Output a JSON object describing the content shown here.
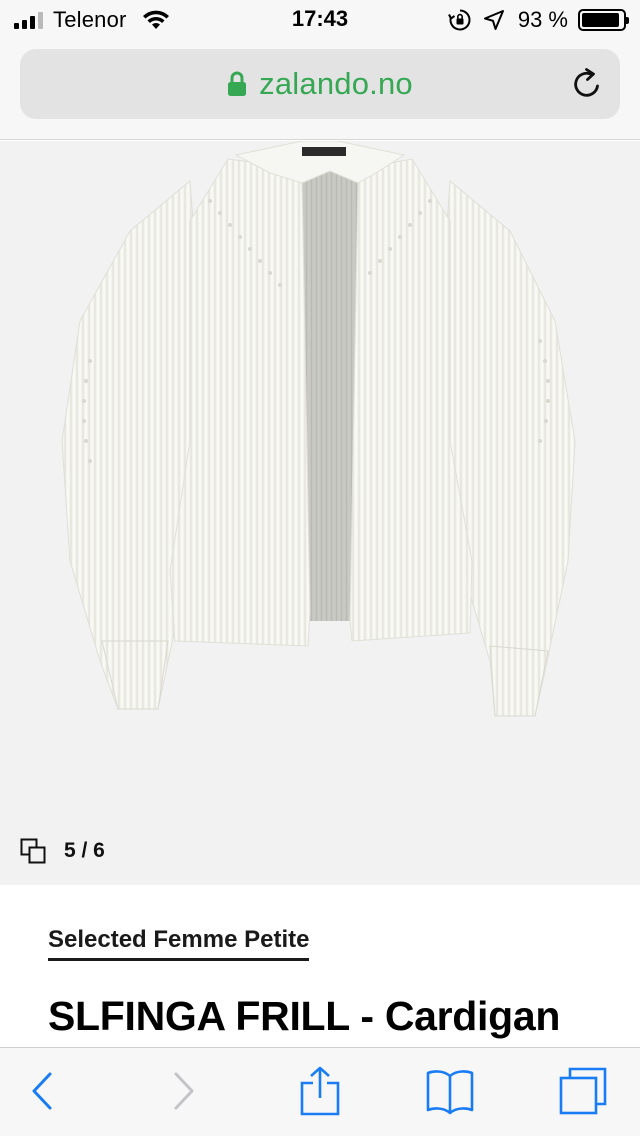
{
  "status_bar": {
    "carrier": "Telenor",
    "time": "17:43",
    "battery_percent_label": "93 %",
    "battery_level": 0.93,
    "icons": [
      "signal-icon",
      "wifi-icon",
      "orientation-lock-icon",
      "location-arrow-icon",
      "battery-icon"
    ]
  },
  "url_bar": {
    "domain": "zalando.no",
    "secure": true,
    "icons": [
      "padlock-icon",
      "reload-icon"
    ],
    "domain_color": "#36a853"
  },
  "gallery": {
    "image_alt": "white knit cardigan",
    "counter": "5 / 6",
    "current": 5,
    "total": 6,
    "icon": "copy-icon",
    "background_color": "#f2f2f2"
  },
  "product": {
    "brand": "Selected Femme Petite",
    "title": "SLFINGA FRILL - Cardigan"
  },
  "toolbar": {
    "back": "back-icon",
    "forward": "forward-icon",
    "share": "share-icon",
    "bookmarks": "bookmarks-icon",
    "tabs": "tabs-icon",
    "accent_color": "#1a7cf5",
    "disabled_color": "#c4c4c8"
  }
}
